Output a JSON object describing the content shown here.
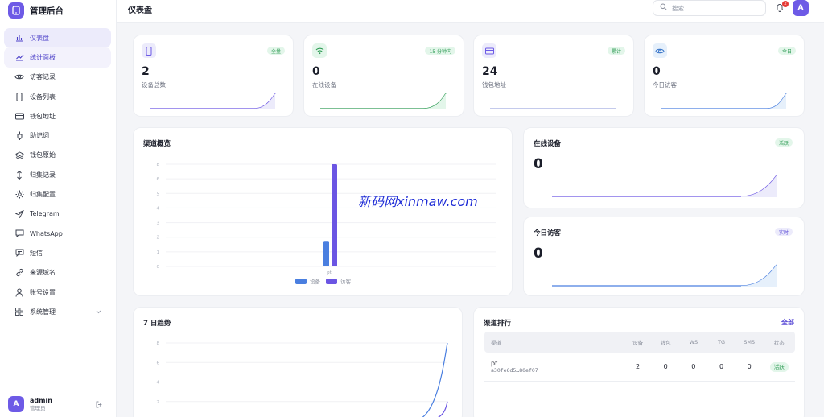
{
  "app": {
    "title": "管理后台"
  },
  "sidebar": {
    "items": [
      {
        "label": "仪表盘",
        "icon": "bar-chart-icon"
      },
      {
        "label": "统计面板",
        "icon": "trend-icon"
      },
      {
        "label": "访客记录",
        "icon": "eye-icon"
      },
      {
        "label": "设备列表",
        "icon": "phone-icon"
      },
      {
        "label": "钱包地址",
        "icon": "wallet-icon"
      },
      {
        "label": "助记词",
        "icon": "key-icon"
      },
      {
        "label": "钱包原始",
        "icon": "layers-icon"
      },
      {
        "label": "归集记录",
        "icon": "arrows-icon"
      },
      {
        "label": "归集配置",
        "icon": "gear-icon"
      },
      {
        "label": "Telegram",
        "icon": "send-icon"
      },
      {
        "label": "WhatsApp",
        "icon": "chat-icon"
      },
      {
        "label": "短信",
        "icon": "message-icon"
      },
      {
        "label": "来源域名",
        "icon": "link-icon"
      },
      {
        "label": "账号设置",
        "icon": "user-icon"
      },
      {
        "label": "系统管理",
        "icon": "grid-icon"
      }
    ]
  },
  "user": {
    "avatar": "A",
    "name": "admin",
    "role": "管理员"
  },
  "header": {
    "title": "仪表盘",
    "search_placeholder": "搜索...",
    "notifications": "2",
    "avatar": "A"
  },
  "stats": [
    {
      "value": "2",
      "label": "设备总数",
      "badge": "全量"
    },
    {
      "value": "0",
      "label": "在线设备",
      "badge": "15 分钟内"
    },
    {
      "value": "24",
      "label": "钱包地址",
      "badge": "累计"
    },
    {
      "value": "0",
      "label": "今日访客",
      "badge": "今日"
    }
  ],
  "colors": {
    "accent": "#6d5ae6",
    "green": "#2e9b54",
    "blue": "#4a7fe0",
    "purple": "#6b55e3"
  },
  "channel_overview": {
    "title": "渠道概览",
    "chart_data": {
      "type": "bar",
      "categories": [
        "pt"
      ],
      "series": [
        {
          "name": "设备",
          "values": [
            2
          ]
        },
        {
          "name": "访客",
          "values": [
            8
          ]
        }
      ],
      "yticks": [
        "0",
        "1",
        "2",
        "3",
        "4",
        "5",
        "6",
        "8"
      ],
      "ylim": [
        0,
        8
      ]
    }
  },
  "online_devices": {
    "title": "在线设备",
    "badge": "活跃",
    "value": "0"
  },
  "today_visitors": {
    "title": "今日访客",
    "badge": "实时",
    "value": "0"
  },
  "watermark": "新码网xinmaw.com",
  "trend": {
    "title": "7 日趋势",
    "chart_data": {
      "type": "line",
      "yticks": [
        "2",
        "4",
        "6",
        "8"
      ],
      "series": [
        {
          "name": "",
          "values": [
            0,
            0,
            0,
            0,
            0,
            0,
            8
          ]
        },
        {
          "name": "",
          "values": [
            0,
            0,
            0,
            0,
            0,
            0,
            2
          ]
        }
      ]
    }
  },
  "ranking": {
    "title": "渠道排行",
    "all_link": "全部",
    "headers": [
      "渠道",
      "设备",
      "钱包",
      "WS",
      "TG",
      "SMS",
      "状态"
    ],
    "rows": [
      {
        "name": "pt",
        "id": "a30fe6d5…80ef07",
        "devices": "2",
        "wallets": "0",
        "ws": "0",
        "tg": "0",
        "sms": "0",
        "status": "活跃"
      }
    ]
  }
}
